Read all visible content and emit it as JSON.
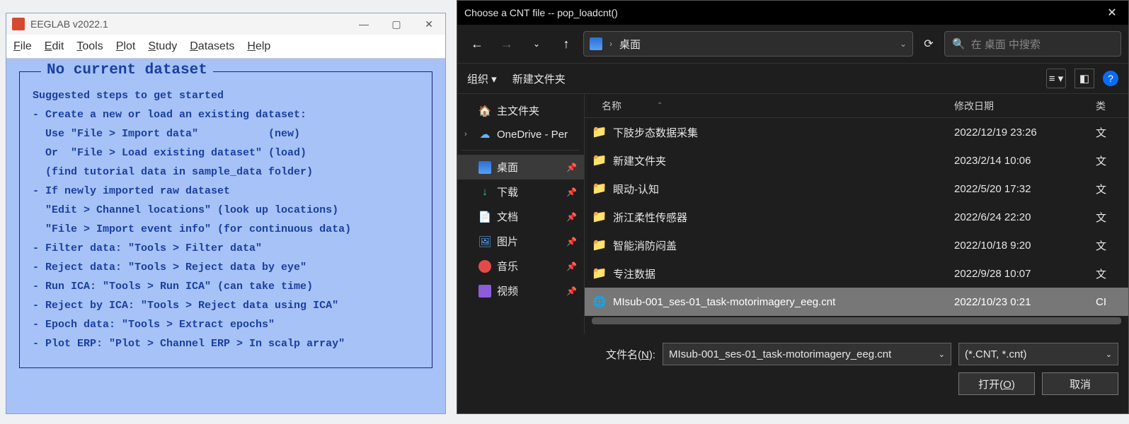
{
  "eeglab": {
    "title": "EEGLAB v2022.1",
    "menu": [
      "File",
      "Edit",
      "Tools",
      "Plot",
      "Study",
      "Datasets",
      "Help"
    ],
    "legend": "No current dataset",
    "body": "Suggested steps to get started\n- Create a new or load an existing dataset:\n  Use \"File > Import data\"           (new)\n  Or  \"File > Load existing dataset\" (load)\n  (find tutorial data in sample_data folder)\n- If newly imported raw dataset\n  \"Edit > Channel locations\" (look up locations)\n  \"File > Import event info\" (for continuous data)\n- Filter data: \"Tools > Filter data\"\n- Reject data: \"Tools > Reject data by eye\"\n- Run ICA: \"Tools > Run ICA\" (can take time)\n- Reject by ICA: \"Tools > Reject data using ICA\"\n- Epoch data: \"Tools > Extract epochs\"\n- Plot ERP: \"Plot > Channel ERP > In scalp array\""
  },
  "dialog": {
    "title": "Choose a CNT file -- pop_loadcnt()",
    "breadcrumb": "桌面",
    "search_placeholder": "在 桌面 中搜索",
    "organize": "组织",
    "new_folder": "新建文件夹",
    "columns": {
      "name": "名称",
      "date": "修改日期",
      "type": "类"
    },
    "tree": {
      "home": "主文件夹",
      "onedrive": "OneDrive - Per",
      "desktop": "桌面",
      "downloads": "下载",
      "documents": "文档",
      "pictures": "图片",
      "music": "音乐",
      "videos": "视频"
    },
    "files": [
      {
        "name": "下肢步态数据采集",
        "date": "2022/12/19 23:26",
        "type": "文",
        "icon": "folder"
      },
      {
        "name": "新建文件夹",
        "date": "2023/2/14 10:06",
        "type": "文",
        "icon": "folder"
      },
      {
        "name": "眼动-认知",
        "date": "2022/5/20 17:32",
        "type": "文",
        "icon": "folder"
      },
      {
        "name": "浙江柔性传感器",
        "date": "2022/6/24 22:20",
        "type": "文",
        "icon": "folder"
      },
      {
        "name": "智能消防闷盖",
        "date": "2022/10/18 9:20",
        "type": "文",
        "icon": "folder"
      },
      {
        "name": "专注数据",
        "date": "2022/9/28 10:07",
        "type": "文",
        "icon": "folder"
      },
      {
        "name": "MIsub-001_ses-01_task-motorimagery_eeg.cnt",
        "date": "2022/10/23 0:21",
        "type": "CI",
        "icon": "file",
        "selected": true
      }
    ],
    "filename_label": "文件名(N):",
    "filename_value": "MIsub-001_ses-01_task-motorimagery_eeg.cnt",
    "filter_value": "(*.CNT, *.cnt)",
    "open": "打开(O)",
    "cancel": "取消"
  }
}
